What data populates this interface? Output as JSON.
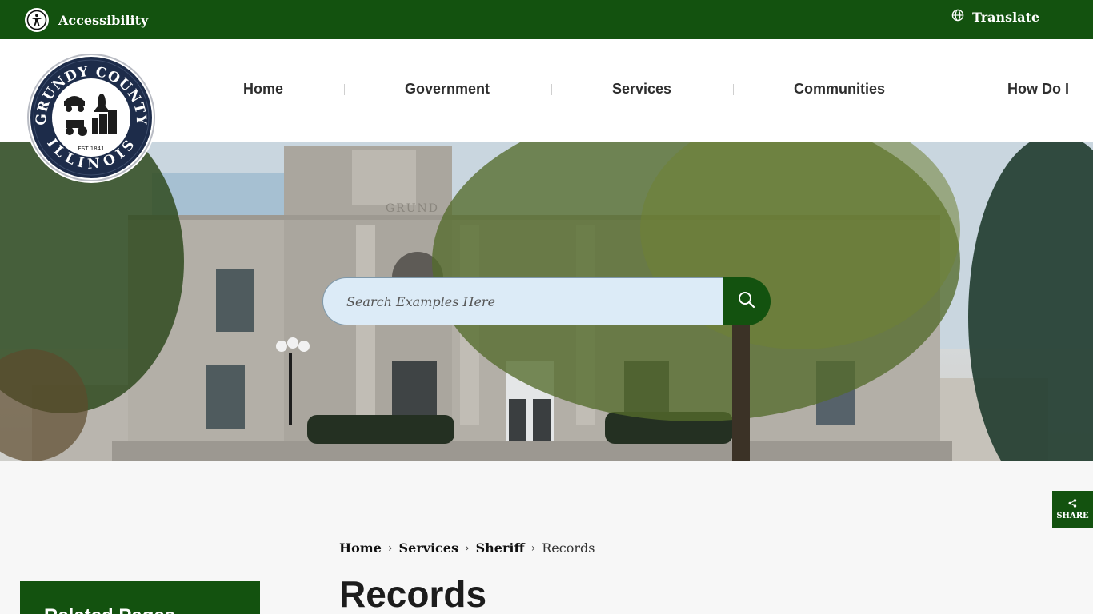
{
  "topbar": {
    "accessibility_label": "Accessibility",
    "translate_label": "Translate"
  },
  "logo": {
    "top_text": "GRUNDY COUNTY",
    "bottom_text": "ILLINOIS",
    "est_text": "EST 1841"
  },
  "nav": {
    "items": [
      {
        "label": "Home"
      },
      {
        "label": "Government"
      },
      {
        "label": "Services"
      },
      {
        "label": "Communities"
      },
      {
        "label": "How Do I"
      }
    ]
  },
  "hero": {
    "building_inscription": "GRUND"
  },
  "search": {
    "placeholder": "Search Examples Here"
  },
  "share": {
    "label": "SHARE"
  },
  "breadcrumb": {
    "items": [
      "Home",
      "Services",
      "Sheriff"
    ],
    "current": "Records"
  },
  "page": {
    "title": "Records"
  },
  "sidebar": {
    "related_title": "Related Pages"
  },
  "colors": {
    "brand_green": "#13520f",
    "search_bg": "#dcebf7",
    "logo_navy": "#1d2c4a"
  }
}
